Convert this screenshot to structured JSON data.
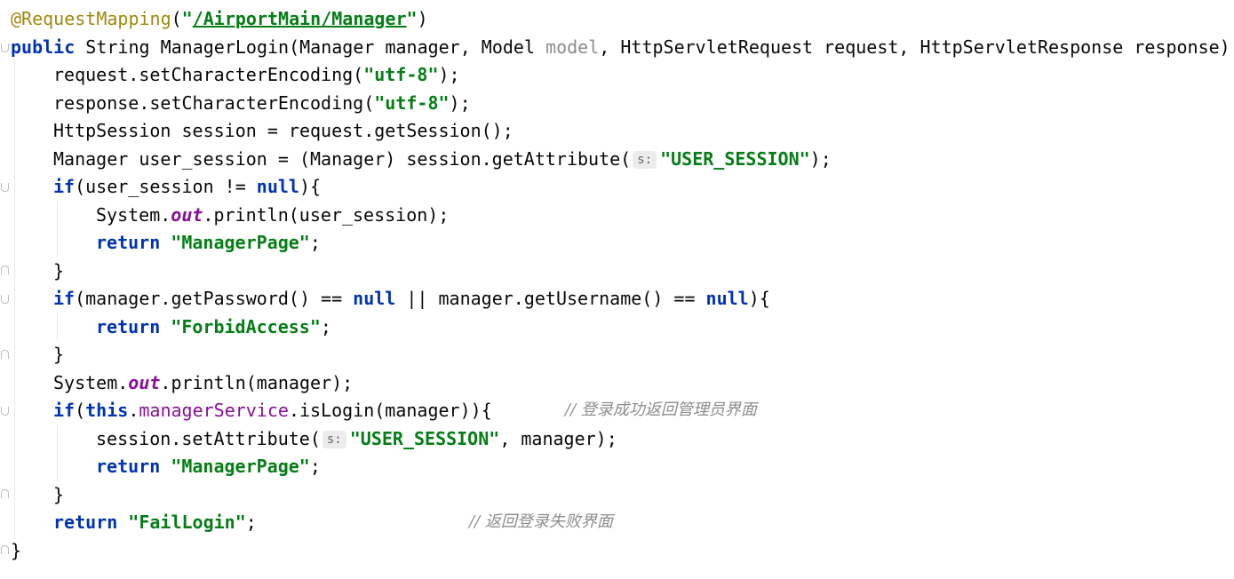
{
  "code": {
    "line1": {
      "annotation": "@RequestMapping",
      "paren_open": "(",
      "q1": "\"",
      "path": "/AirportMain/Manager",
      "q2": "\"",
      "paren_close": ")"
    },
    "line2": {
      "kw_public": "public",
      "sig_a": " String ManagerLogin(Manager manager, Model ",
      "unused_param": "model",
      "sig_b": ", HttpServletRequest request, HttpServletResponse response)"
    },
    "line3": {
      "pre": "request.setCharacterEncoding(",
      "str": "\"utf-8\"",
      "post": ");"
    },
    "line4": {
      "pre": "response.setCharacterEncoding(",
      "str": "\"utf-8\"",
      "post": ");"
    },
    "line5": {
      "text": "HttpSession session = request.getSession();"
    },
    "line6": {
      "pre": "Manager user_session = (Manager) session.getAttribute(",
      "hint": "s:",
      "str": "\"USER_SESSION\"",
      "post": ");"
    },
    "line7": {
      "kw_if": "if",
      "mid": "(user_session != ",
      "kw_null": "null",
      "post": "){"
    },
    "line8": {
      "pre": "System.",
      "field": "out",
      "post": ".println(user_session);"
    },
    "line9": {
      "kw_return": "return",
      "sp": " ",
      "str": "\"ManagerPage\"",
      "post": ";"
    },
    "line10": {
      "text": "}"
    },
    "line11": {
      "kw_if": "if",
      "mid_a": "(manager.getPassword() == ",
      "kw_null_a": "null",
      "mid_b": " || manager.getUsername() == ",
      "kw_null_b": "null",
      "post": "){"
    },
    "line12": {
      "kw_return": "return",
      "sp": " ",
      "str": "\"ForbidAccess\"",
      "post": ";"
    },
    "line13": {
      "text": "}"
    },
    "line14": {
      "pre": "System.",
      "field": "out",
      "post": ".println(manager);"
    },
    "line15": {
      "kw_if": "if",
      "paren": "(",
      "kw_this": "this",
      "dot": ".",
      "member": "managerService",
      "post": ".isLogin(manager)){",
      "comment": "// 登录成功返回管理员界面"
    },
    "line16": {
      "pre": "session.setAttribute(",
      "hint": "s:",
      "str": "\"USER_SESSION\"",
      "post": ", manager);"
    },
    "line17": {
      "kw_return": "return",
      "sp": " ",
      "str": "\"ManagerPage\"",
      "post": ";"
    },
    "line18": {
      "text": "}"
    },
    "line19": {
      "kw_return": "return",
      "sp": " ",
      "str": "\"FailLogin\"",
      "post": ";",
      "comment": "// 返回登录失败界面"
    },
    "line20": {
      "text": "}"
    }
  }
}
